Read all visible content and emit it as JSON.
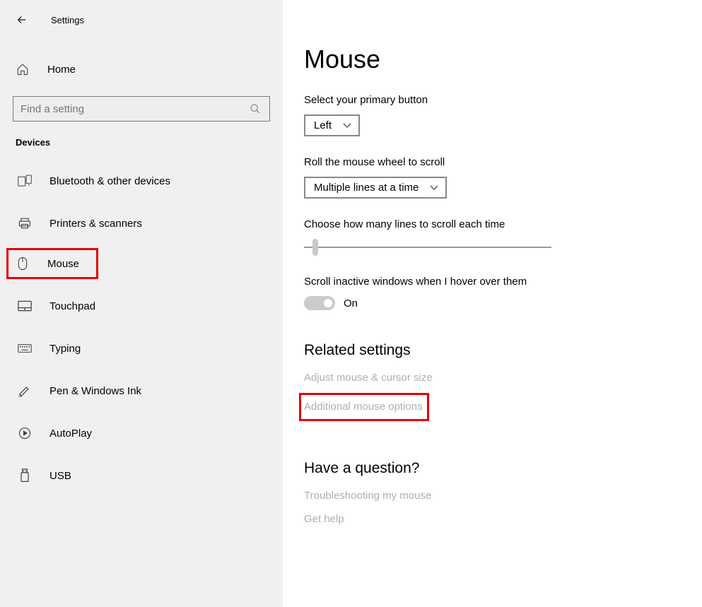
{
  "header": {
    "app_title": "Settings"
  },
  "sidebar": {
    "home_label": "Home",
    "search_placeholder": "Find a setting",
    "section_label": "Devices",
    "items": [
      {
        "label": "Bluetooth & other devices",
        "icon": "bluetooth"
      },
      {
        "label": "Printers & scanners",
        "icon": "printer"
      },
      {
        "label": "Mouse",
        "icon": "mouse"
      },
      {
        "label": "Touchpad",
        "icon": "touchpad"
      },
      {
        "label": "Typing",
        "icon": "keyboard"
      },
      {
        "label": "Pen & Windows Ink",
        "icon": "pen"
      },
      {
        "label": "AutoPlay",
        "icon": "autoplay"
      },
      {
        "label": "USB",
        "icon": "usb"
      }
    ]
  },
  "main": {
    "title": "Mouse",
    "primary_button": {
      "label": "Select your primary button",
      "value": "Left"
    },
    "roll_wheel": {
      "label": "Roll the mouse wheel to scroll",
      "value": "Multiple lines at a time"
    },
    "lines_scroll": {
      "label": "Choose how many lines to scroll each time"
    },
    "scroll_inactive": {
      "label": "Scroll inactive windows when I hover over them",
      "value": "On"
    },
    "related_heading": "Related settings",
    "related_links": [
      "Adjust mouse & cursor size",
      "Additional mouse options"
    ],
    "question_heading": "Have a question?",
    "question_links": [
      "Troubleshooting my mouse",
      "Get help"
    ]
  }
}
